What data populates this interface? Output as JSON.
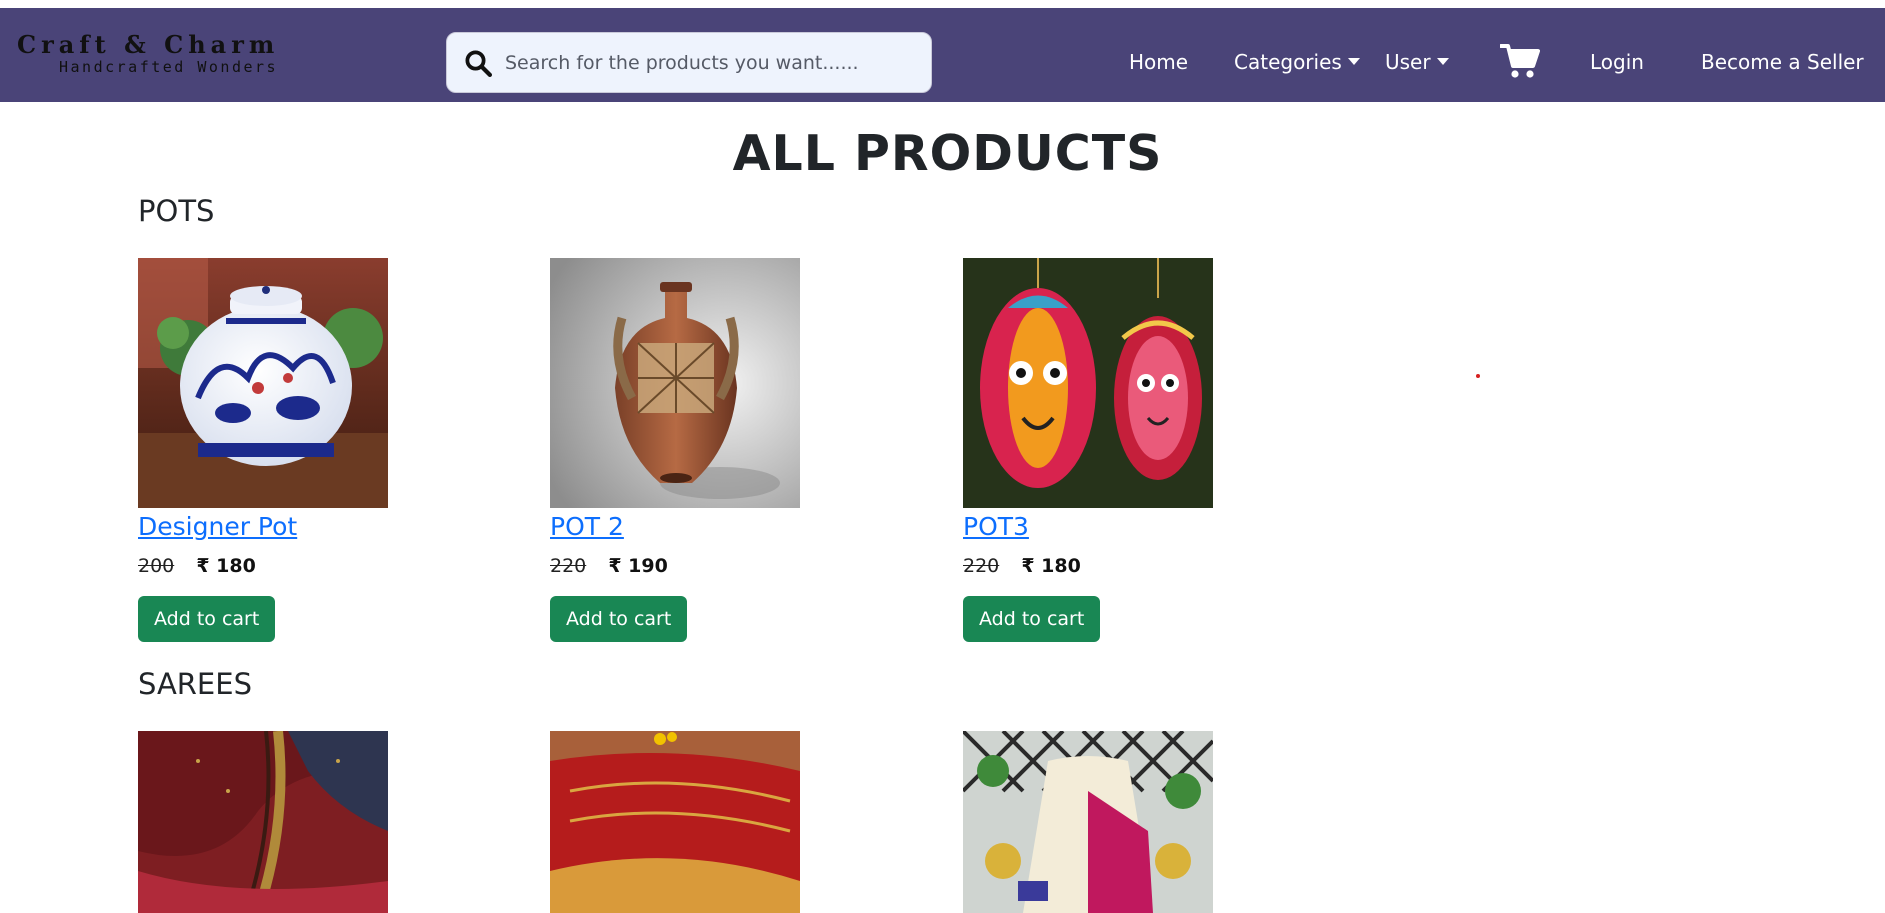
{
  "brand": {
    "title": "Craft & Charm",
    "subtitle": "Handcrafted Wonders"
  },
  "search": {
    "placeholder": "Search for the products you want......"
  },
  "nav": {
    "home": "Home",
    "categories": "Categories",
    "user": "User",
    "login": "Login",
    "seller": "Become a Seller"
  },
  "icons": {
    "search": "search-icon",
    "cart": "cart-icon",
    "caret": "caret-down-icon"
  },
  "colors": {
    "navbar": "#4a4478",
    "link": "#0d6efd",
    "button": "#198754"
  },
  "page": {
    "title": "ALL PRODUCTS"
  },
  "sections": [
    {
      "title": "POTS",
      "products": [
        {
          "name": "Designer Pot",
          "old_price": "200",
          "price": "₹ 180",
          "button": "Add to cart"
        },
        {
          "name": "POT 2",
          "old_price": "220",
          "price": "₹ 190",
          "button": "Add to cart"
        },
        {
          "name": "POT3",
          "old_price": "220",
          "price": "₹ 180",
          "button": "Add to cart"
        }
      ]
    },
    {
      "title": "SAREES",
      "products": [
        {
          "name": "",
          "old_price": "",
          "price": "",
          "button": ""
        },
        {
          "name": "",
          "old_price": "",
          "price": "",
          "button": ""
        },
        {
          "name": "",
          "old_price": "",
          "price": "",
          "button": ""
        }
      ]
    }
  ]
}
